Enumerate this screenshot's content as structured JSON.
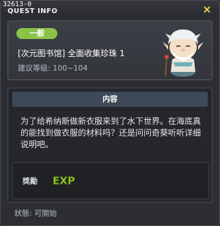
{
  "window": {
    "quest_id": "32613-0",
    "title": "QUEST INFO",
    "close_glyph": "×"
  },
  "quest": {
    "badge": "一般",
    "name": "[次元图书馆] 全面收集珍珠 1",
    "level": "建议等级: 100~104"
  },
  "content": {
    "header": "内容",
    "description": "为了给希纳斯做新衣服来到了水下世界。在海底真的能找到做衣服的材料吗？还是问问奇葵听听详细说明吧。",
    "reward_label": "獎勵",
    "reward_icon": "exp-icon",
    "reward_text": "EXP"
  },
  "status": {
    "text": "狀態: 可開始"
  },
  "colors": {
    "badge": "#8bc34a",
    "exp": "#a4e02a",
    "close": "#f7d44a"
  }
}
